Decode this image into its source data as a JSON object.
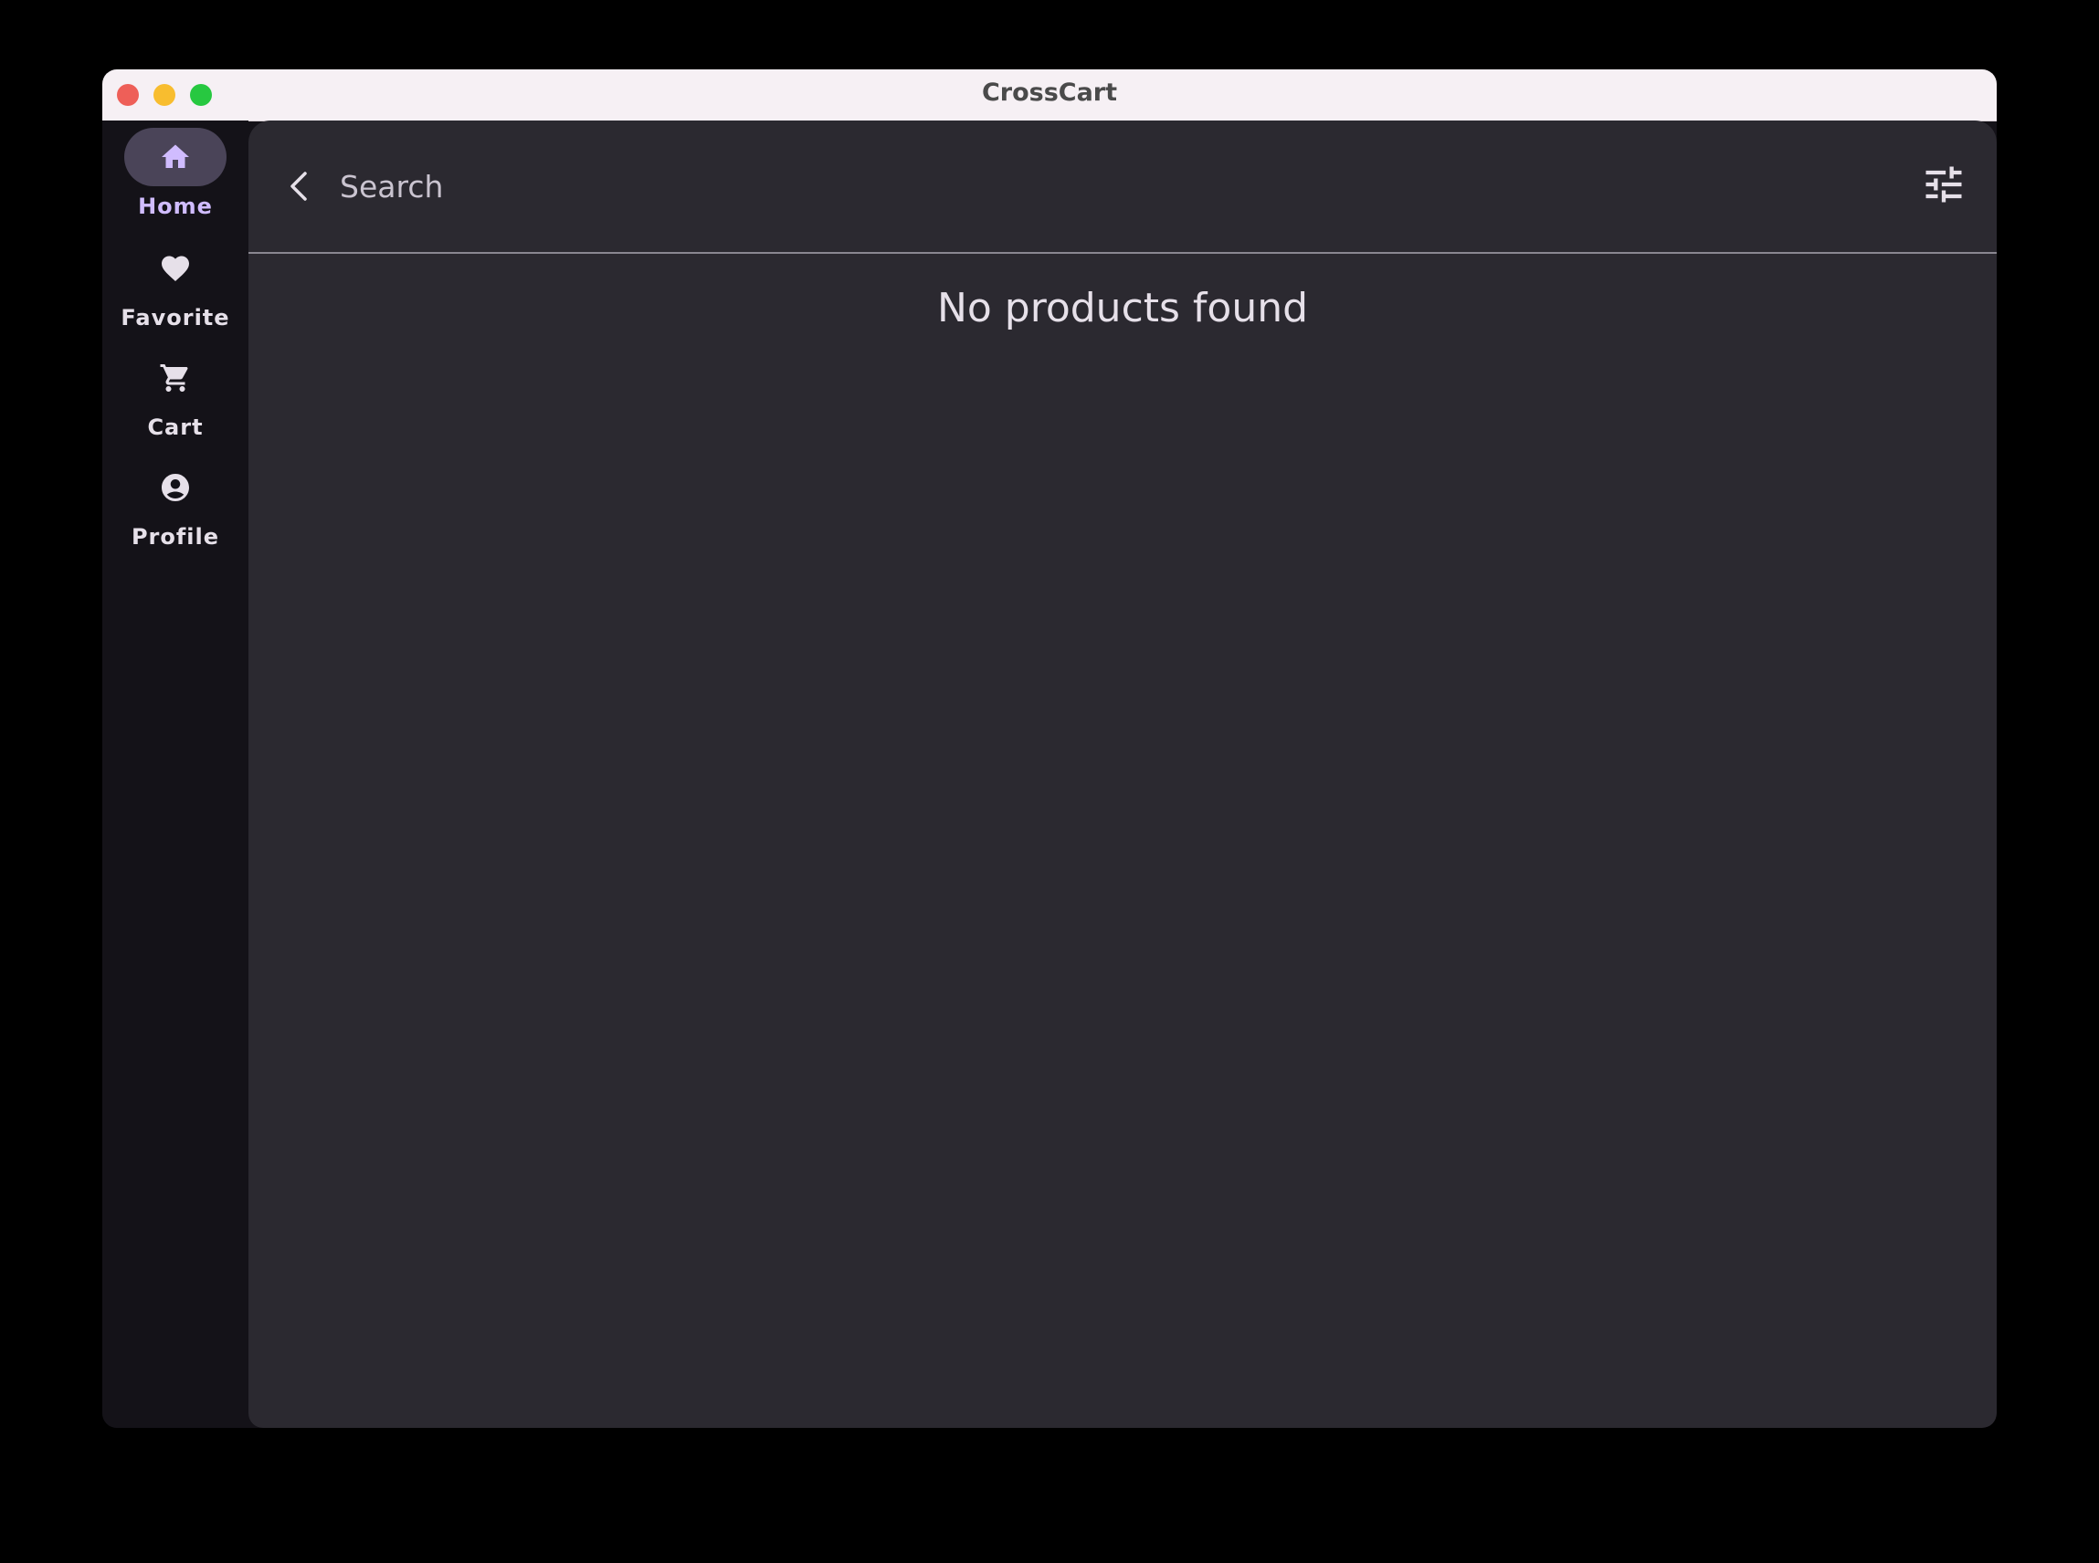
{
  "window": {
    "title": "CrossCart"
  },
  "navigation": {
    "items": [
      {
        "label": "Home",
        "icon": "home-icon",
        "active": true
      },
      {
        "label": "Favorite",
        "icon": "heart-icon",
        "active": false
      },
      {
        "label": "Cart",
        "icon": "cart-icon",
        "active": false
      },
      {
        "label": "Profile",
        "icon": "account-circle-icon",
        "active": false
      }
    ]
  },
  "search": {
    "placeholder": "Search",
    "value": ""
  },
  "results": {
    "empty_message": "No products found"
  },
  "colors": {
    "accent": "#d0bcff",
    "active_indicator": "#4a4458",
    "surface": "#2b2930",
    "rail_background": "#141218"
  }
}
